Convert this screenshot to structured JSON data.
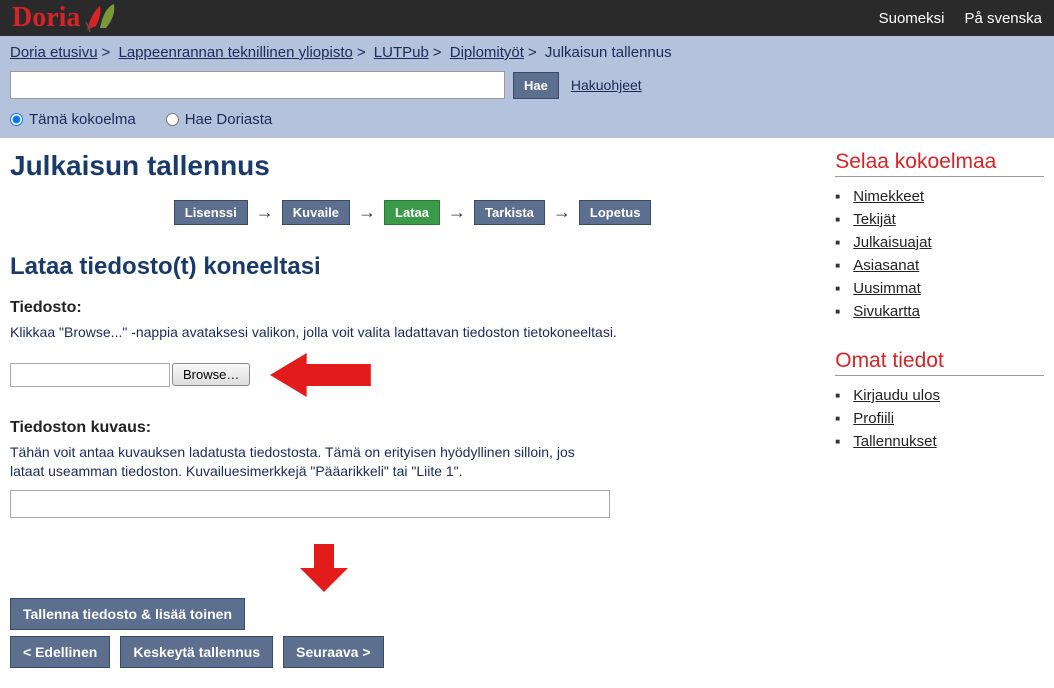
{
  "topbar": {
    "logo_text": "Doria",
    "lang": {
      "fi": "Suomeksi",
      "sv": "På svenska"
    }
  },
  "breadcrumb": {
    "items": [
      {
        "label": "Doria etusivu",
        "link": true
      },
      {
        "label": "Lappeenrannan teknillinen yliopisto",
        "link": true
      },
      {
        "label": "LUTPub",
        "link": true
      },
      {
        "label": "Diplomityöt",
        "link": true
      },
      {
        "label": "Julkaisun tallennus",
        "link": false
      }
    ]
  },
  "search": {
    "button": "Hae",
    "help": "Hakuohjeet",
    "radio_this": "Tämä kokoelma",
    "radio_all": "Hae Doriasta"
  },
  "page": {
    "title": "Julkaisun tallennus",
    "subtitle": "Lataa tiedosto(t) koneeltasi"
  },
  "steps": {
    "s1": "Lisenssi",
    "s2": "Kuvaile",
    "s3": "Lataa",
    "s4": "Tarkista",
    "s5": "Lopetus"
  },
  "file": {
    "label": "Tiedosto:",
    "help": "Klikkaa \"Browse...\" -nappia avataksesi valikon, jolla voit valita ladattavan tiedoston tietokoneeltasi.",
    "browse": "Browse…"
  },
  "desc": {
    "label": "Tiedoston kuvaus:",
    "help": "Tähän voit antaa kuvauksen ladatusta tiedostosta. Tämä on erityisen hyödyllinen silloin, jos lataat useamman tiedoston. Kuvailuesimerkkejä \"Pääarikkeli\" tai \"Liite 1\"."
  },
  "buttons": {
    "save_add": "Tallenna tiedosto & lisää toinen",
    "prev": "< Edellinen",
    "cancel": "Keskeytä tallennus",
    "next": "Seuraava >"
  },
  "sidebar": {
    "browse_heading": "Selaa kokoelmaa",
    "browse_items": [
      "Nimekkeet",
      "Tekijät",
      "Julkaisuajat",
      "Asiasanat",
      "Uusimmat",
      "Sivukartta"
    ],
    "account_heading": "Omat tiedot",
    "account_items": [
      "Kirjaudu ulos",
      "Profiili",
      "Tallennukset"
    ]
  }
}
